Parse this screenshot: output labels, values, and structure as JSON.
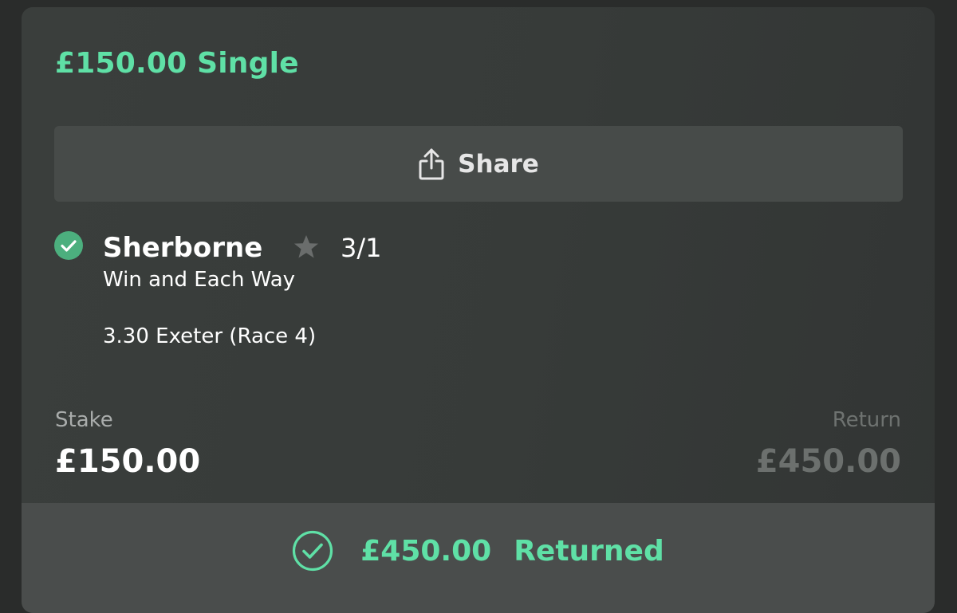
{
  "bet": {
    "title": "£150.00 Single",
    "share_label": "Share",
    "selection": {
      "name": "Sherborne",
      "odds": "3/1",
      "market": "Win and Each Way",
      "event": "3.30 Exeter (Race 4)",
      "status_icon": "check-circle-icon",
      "favourite_icon": "star-icon"
    },
    "stake_label": "Stake",
    "stake_value": "£150.00",
    "return_label": "Return",
    "return_value": "£450.00",
    "returned": {
      "amount": "£450.00",
      "label": "Returned",
      "icon": "check-circle-outline-icon"
    }
  },
  "colors": {
    "accent": "#5fe0a6",
    "card_bg": "#393c3b",
    "share_bg": "#474b49",
    "returned_bar_bg": "#4a4d4c",
    "win_check": "#4caf7e"
  }
}
